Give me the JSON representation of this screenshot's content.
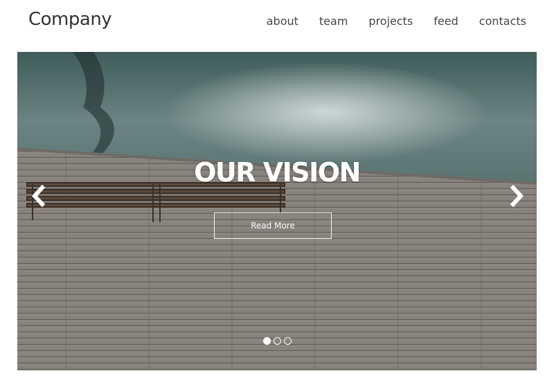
{
  "header": {
    "brand": "Company",
    "nav": [
      "about",
      "team",
      "projects",
      "feed",
      "contacts"
    ]
  },
  "slider": {
    "title": "OUR VISION",
    "button_label": "Read More",
    "slide_count": 3,
    "active_slide": 1,
    "prev_icon": "chevron-left-icon",
    "next_icon": "chevron-right-icon"
  },
  "colors": {
    "text": "#333333",
    "nav_text": "#444444",
    "overlay_text": "#ffffff",
    "water": "#4e6b68",
    "deck": "#8f8a84"
  }
}
